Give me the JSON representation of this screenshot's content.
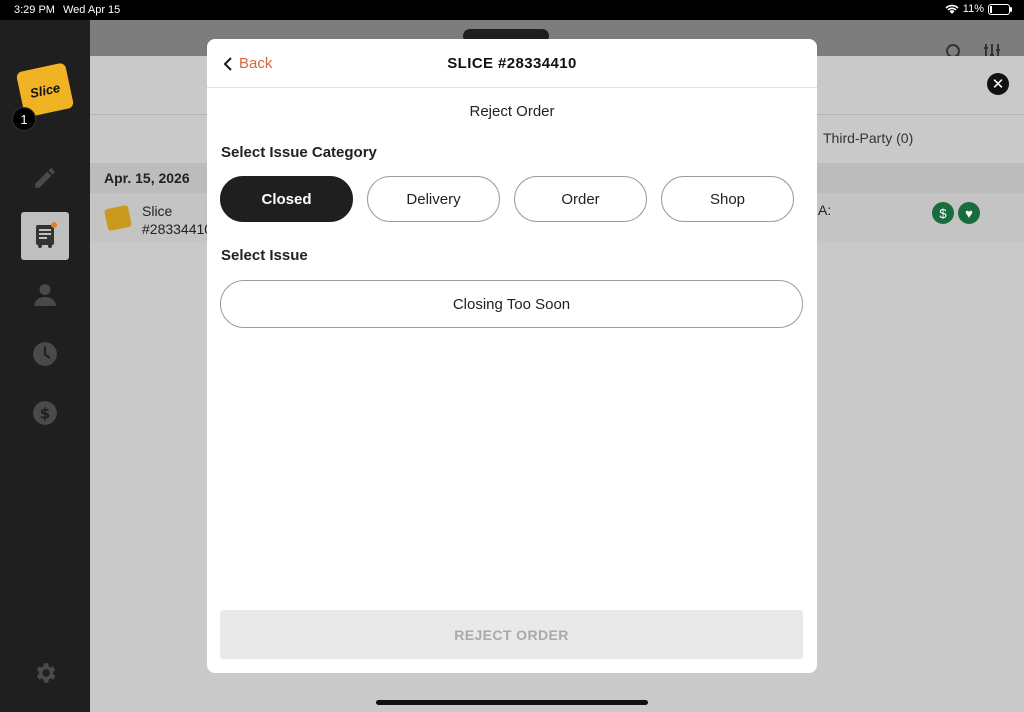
{
  "status_bar": {
    "time": "3:29 PM",
    "date": "Wed Apr 15",
    "battery": "11%",
    "battery_level": 0.11
  },
  "sidebar": {
    "logo_text": "Slice",
    "badge_count": "1"
  },
  "background": {
    "tab_third_party": "Third-Party (0)",
    "date_header": "Apr. 15, 2026",
    "order_name": "Slice",
    "order_number": "#28334410",
    "column_a": "A:",
    "status_icons": [
      "$",
      "♥"
    ]
  },
  "modal": {
    "back_label": "Back",
    "title": "SLICE #28334410",
    "subtitle": "Reject Order",
    "category_label": "Select Issue Category",
    "categories": [
      {
        "label": "Closed",
        "selected": true
      },
      {
        "label": "Delivery",
        "selected": false
      },
      {
        "label": "Order",
        "selected": false
      },
      {
        "label": "Shop",
        "selected": false
      }
    ],
    "issue_label": "Select Issue",
    "issue_value": "Closing Too Soon",
    "reject_button": "REJECT ORDER"
  }
}
